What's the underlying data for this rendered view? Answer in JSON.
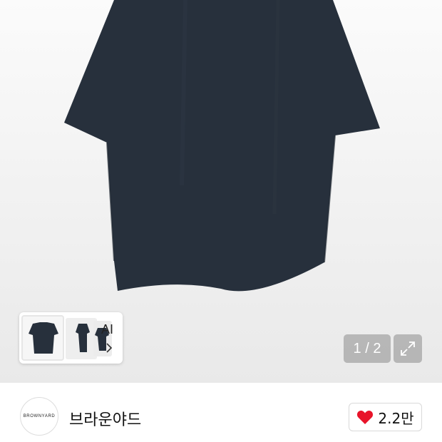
{
  "gallery": {
    "counter": "1 / 2",
    "ai_label": "AI",
    "colors": {
      "shirt": "#27303c"
    }
  },
  "brand": {
    "logo_text": "BROWNYARD",
    "name": "브라운야드"
  },
  "like": {
    "count": "2.2만",
    "icon": "heart-icon",
    "color": "#e8142a"
  }
}
